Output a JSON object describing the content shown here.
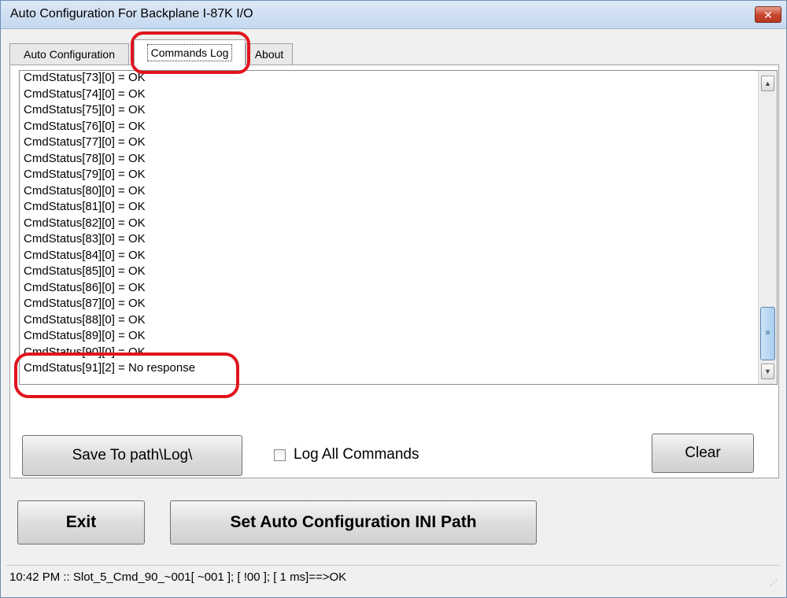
{
  "window": {
    "title": "Auto Configuration For Backplane I-87K I/O",
    "close_icon": "close-icon"
  },
  "tabs": [
    {
      "label": "Auto Configuration",
      "active": false
    },
    {
      "label": "Commands Log",
      "active": true
    },
    {
      "label": "About",
      "active": false
    }
  ],
  "log": {
    "lines": [
      "CmdStatus[73][0] = OK",
      "CmdStatus[74][0] = OK",
      "CmdStatus[75][0] = OK",
      "CmdStatus[76][0] = OK",
      "CmdStatus[77][0] = OK",
      "CmdStatus[78][0] = OK",
      "CmdStatus[79][0] = OK",
      "CmdStatus[80][0] = OK",
      "CmdStatus[81][0] = OK",
      "CmdStatus[82][0] = OK",
      "CmdStatus[83][0] = OK",
      "CmdStatus[84][0] = OK",
      "CmdStatus[85][0] = OK",
      "CmdStatus[86][0] = OK",
      "CmdStatus[87][0] = OK",
      "CmdStatus[88][0] = OK",
      "CmdStatus[89][0] = OK",
      "CmdStatus[90][0] = OK",
      "CmdStatus[91][2] = No response"
    ],
    "scroll_up_icon": "▲",
    "scroll_down_icon": "▼",
    "thumb_grip": "≡"
  },
  "controls": {
    "save_label": "Save To path\\Log\\",
    "log_all_label": "Log All Commands",
    "log_all_checked": false,
    "clear_label": "Clear"
  },
  "bottom": {
    "exit_label": "Exit",
    "set_path_label": "Set Auto Configuration INI Path"
  },
  "status": {
    "text": "10:42 PM :: Slot_5_Cmd_90_~001[ ~001 ]; [ !00 ]; [ 1 ms]==>OK"
  },
  "colors": {
    "annotation": "#e0141e",
    "titlebar": "#c5d8ee",
    "close_button": "#c8452d"
  }
}
